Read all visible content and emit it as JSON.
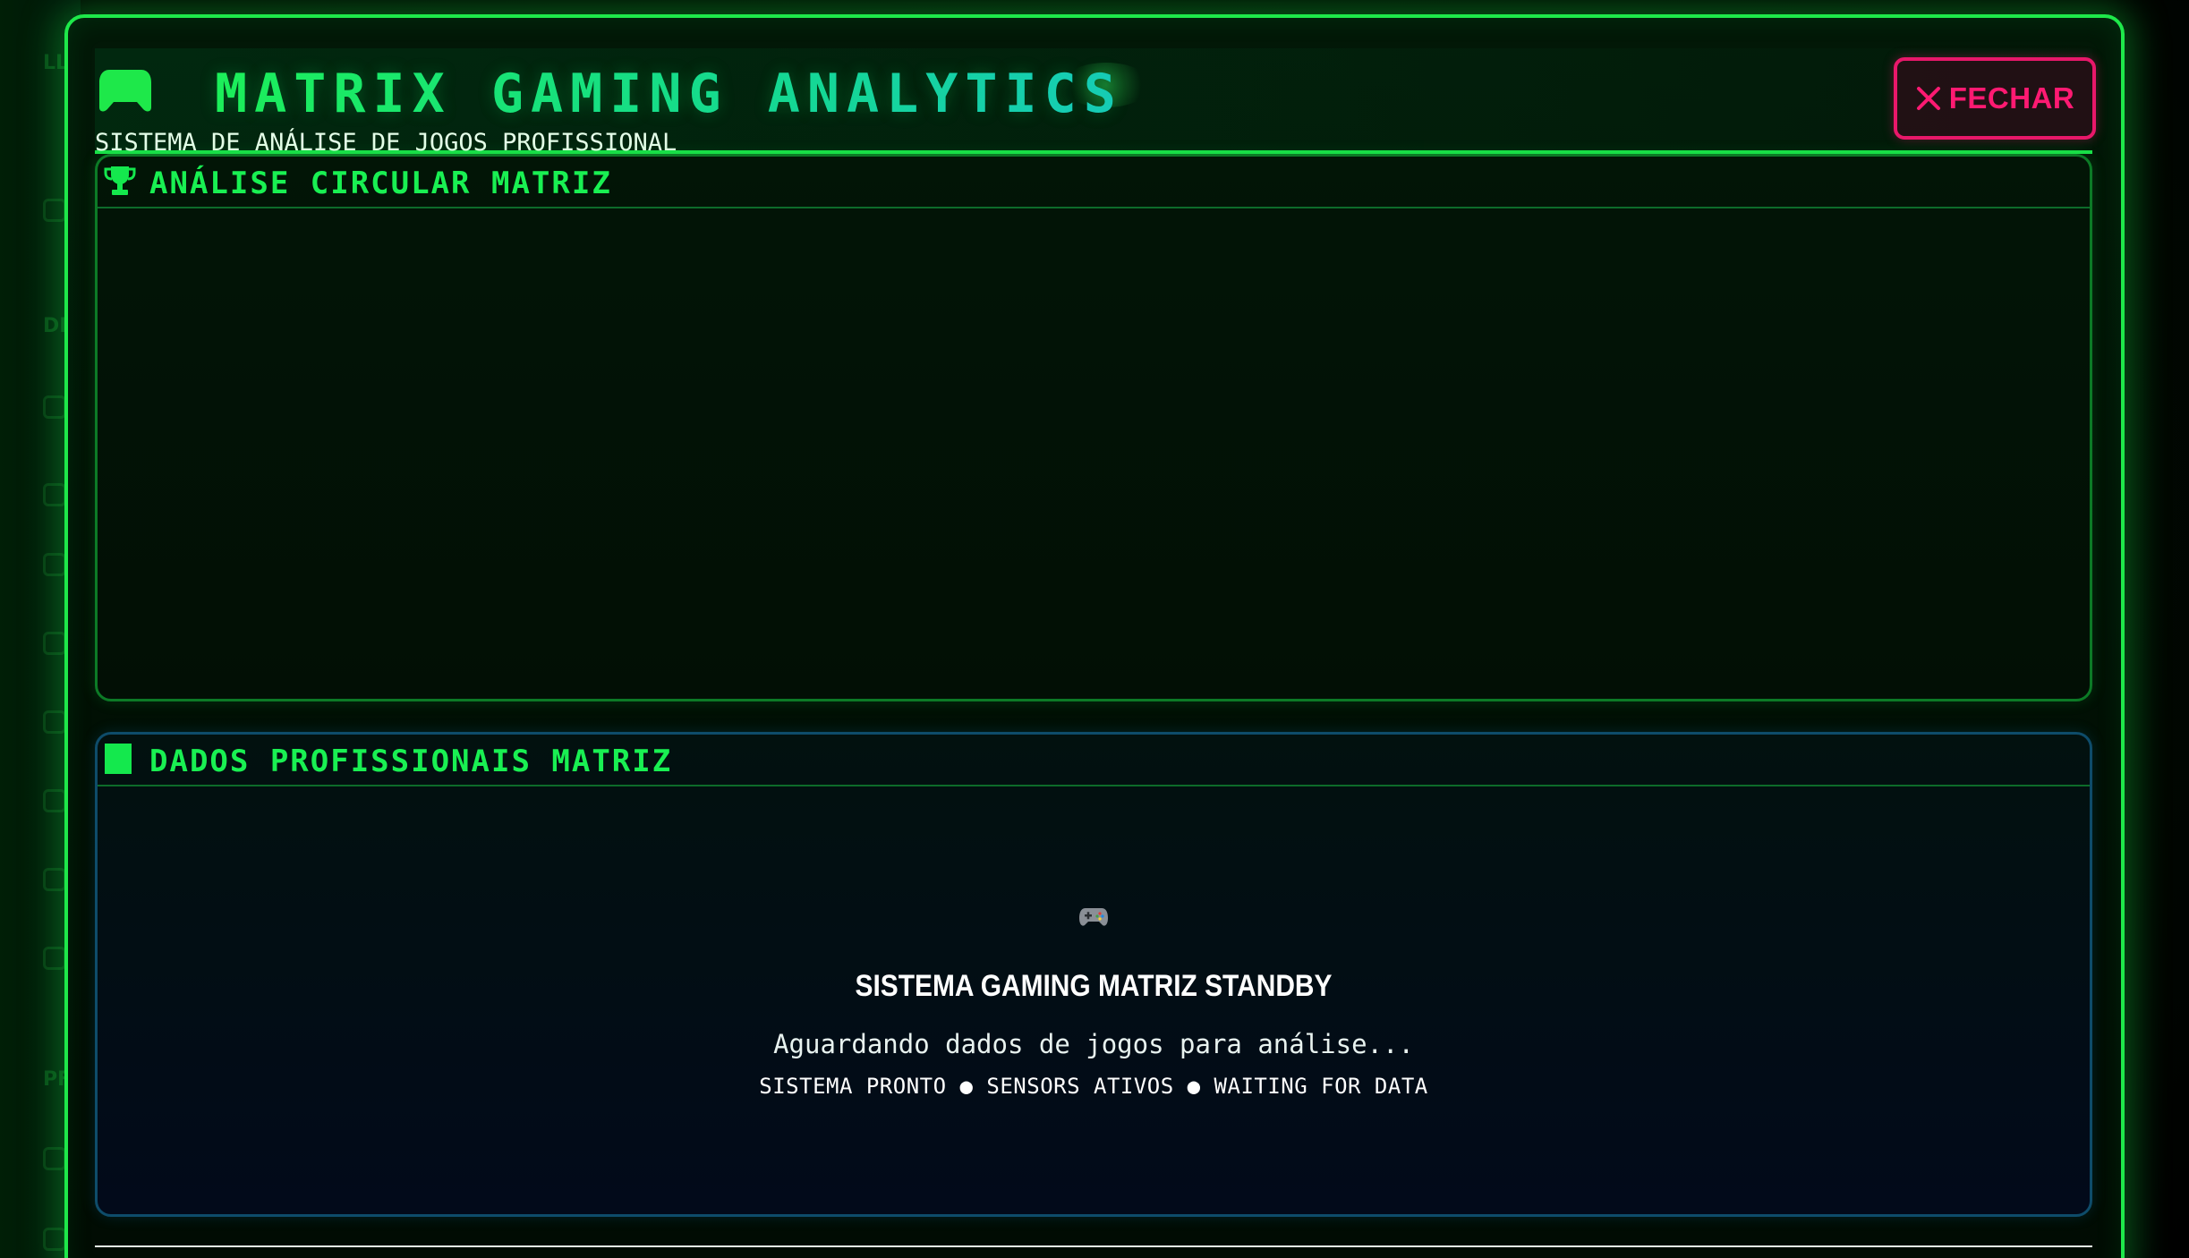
{
  "background": {
    "sidebar_labels": [
      "LL",
      "DE",
      "PF"
    ]
  },
  "header": {
    "title": "MATRIX GAMING ANALYTICS",
    "subtitle": "SISTEMA DE ANÁLISE DE JOGOS PROFISSIONAL",
    "logo_icon": "gamepad-icon",
    "close_label": "FECHAR",
    "close_icon": "close-icon"
  },
  "panels": {
    "chart": {
      "title": "ANÁLISE CIRCULAR MATRIZ",
      "icon": "trophy-icon"
    },
    "data": {
      "title": "DADOS PROFISSIONAIS MATRIZ",
      "icon": "square-icon",
      "standby_icon": "gamepad-emoji-icon",
      "standby_title": "SISTEMA GAMING MATRIZ STANDBY",
      "standby_description": "Aguardando dados de jogos para análise...",
      "standby_status": "SISTEMA PRONTO ● SENSORS ATIVOS ● WAITING FOR DATA"
    }
  },
  "colors": {
    "accent": "#1ee84a",
    "close": "#e8186a",
    "title_gradient_end": "#17c9c0"
  }
}
